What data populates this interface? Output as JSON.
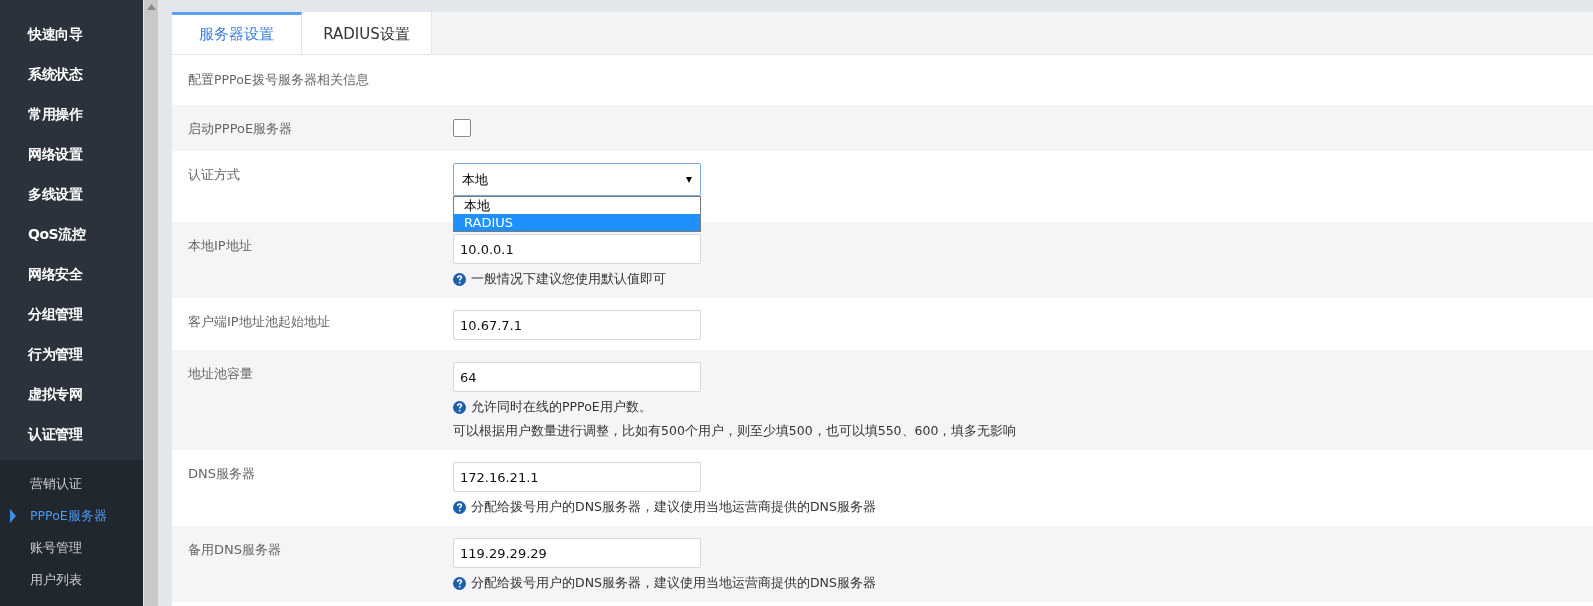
{
  "sidebar": {
    "items": [
      {
        "label": "快速向导"
      },
      {
        "label": "系统状态"
      },
      {
        "label": "常用操作"
      },
      {
        "label": "网络设置"
      },
      {
        "label": "多线设置"
      },
      {
        "label": "QoS流控"
      },
      {
        "label": "网络安全"
      },
      {
        "label": "分组管理"
      },
      {
        "label": "行为管理"
      },
      {
        "label": "虚拟专网"
      },
      {
        "label": "认证管理",
        "children": [
          {
            "label": "营销认证",
            "selected": false
          },
          {
            "label": "PPPoE服务器",
            "selected": true
          },
          {
            "label": "账号管理",
            "selected": false
          },
          {
            "label": "用户列表",
            "selected": false
          }
        ]
      }
    ]
  },
  "tabs": [
    {
      "label": "服务器设置",
      "selected": true
    },
    {
      "label": "RADIUS设置",
      "selected": false
    }
  ],
  "description": "配置PPPoE拨号服务器相关信息",
  "form": {
    "rows": [
      {
        "kind": "checkbox",
        "label": "启动PPPoE服务器",
        "checked": false
      },
      {
        "kind": "select",
        "label": "认证方式",
        "value": "本地",
        "expanded": true,
        "options": [
          {
            "label": "本地",
            "highlighted": false
          },
          {
            "label": "RADIUS",
            "highlighted": true
          }
        ]
      },
      {
        "kind": "text",
        "label": "本地IP地址",
        "value": "10.0.0.1",
        "hints": [
          {
            "kind": "info",
            "text": "一般情况下建议您使用默认值即可"
          }
        ]
      },
      {
        "kind": "text",
        "label": "客户端IP地址池起始地址",
        "value": "10.67.7.1"
      },
      {
        "kind": "text",
        "label": "地址池容量",
        "value": "64",
        "hints": [
          {
            "kind": "info",
            "text": "允许同时在线的PPPoE用户数。"
          },
          {
            "kind": "plain",
            "text": "可以根据用户数量进行调整，比如有500个用户，则至少填500，也可以填550、600，填多无影响"
          }
        ]
      },
      {
        "kind": "text",
        "label": "DNS服务器",
        "value": "172.16.21.1",
        "hints": [
          {
            "kind": "info",
            "text": "分配给拨号用户的DNS服务器，建议使用当地运营商提供的DNS服务器"
          }
        ]
      },
      {
        "kind": "text",
        "label": "备用DNS服务器",
        "value": "119.29.29.29",
        "hints": [
          {
            "kind": "info",
            "text": "分配给拨号用户的DNS服务器，建议使用当地运营商提供的DNS服务器"
          }
        ]
      }
    ]
  }
}
